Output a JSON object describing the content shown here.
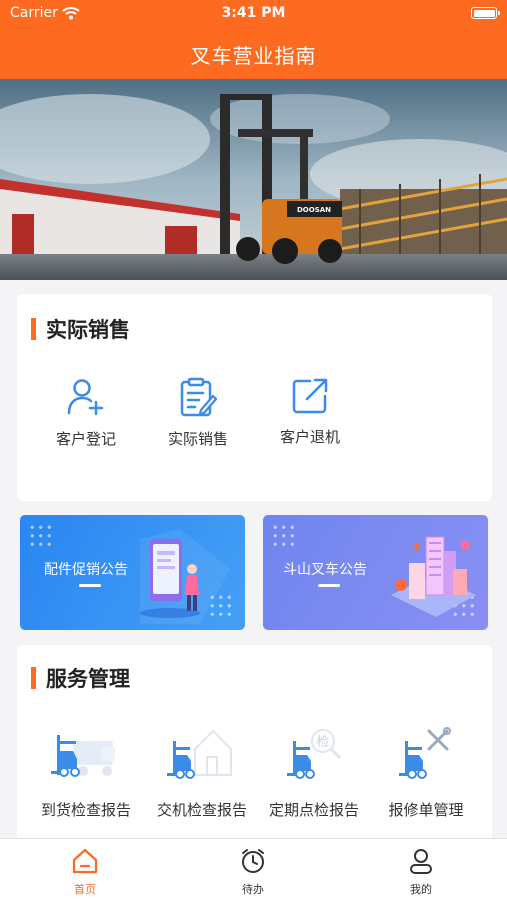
{
  "status_bar": {
    "carrier": "Carrier",
    "time": "3:41 PM"
  },
  "header": {
    "title": "叉车营业指南"
  },
  "banner": {
    "brand_text": "DOOSAN"
  },
  "sales": {
    "title": "实际销售",
    "actions": [
      {
        "label": "客户登记",
        "icon": "user-add-icon"
      },
      {
        "label": "实际销售",
        "icon": "clipboard-edit-icon"
      },
      {
        "label": "客户退机",
        "icon": "external-link-icon"
      }
    ]
  },
  "promos": [
    {
      "title": "配件促销公告"
    },
    {
      "title": "斗山叉车公告"
    }
  ],
  "service": {
    "title": "服务管理",
    "items": [
      {
        "label": "到货检查报告",
        "icon": "forklift-truck-icon"
      },
      {
        "label": "交机检查报告",
        "icon": "forklift-house-icon"
      },
      {
        "label": "定期点检报告",
        "icon": "forklift-inspect-icon",
        "badge": "检"
      },
      {
        "label": "报修单管理",
        "icon": "forklift-repair-icon"
      }
    ]
  },
  "tabs": [
    {
      "label": "首页",
      "icon": "home-icon",
      "active": true
    },
    {
      "label": "待办",
      "icon": "alarm-clock-icon",
      "active": false
    },
    {
      "label": "我的",
      "icon": "user-icon",
      "active": false
    }
  ],
  "colors": {
    "accent": "#fe6a1f",
    "blue_icon": "#3b8be8",
    "promo_left": "#2d8ef3",
    "promo_right": "#6f86ef"
  }
}
